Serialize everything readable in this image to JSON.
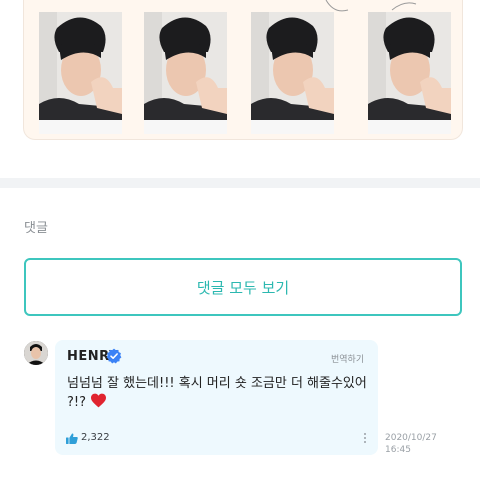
{
  "gallery": {
    "photos": [
      "photo-1",
      "photo-2",
      "photo-3",
      "photo-4"
    ]
  },
  "comments_section": {
    "title": "댓글",
    "view_all_label": "댓글 모두 보기"
  },
  "comment": {
    "author": "HENRY",
    "verified": true,
    "translate_label": "번역하기",
    "text": "넘넘넘 잘 했는데!!! 혹시 머리 숏 조금만 더 해줄수있어 ?!?",
    "like_count": "2,322",
    "date": "2020/10/27",
    "time": "16:45"
  },
  "colors": {
    "accent": "#3ec6be",
    "verified": "#3b82f6",
    "heart": "#e0242f",
    "bubble": "#eef9fe",
    "like_icon": "#2f9fd8"
  },
  "icons": [
    "verified-badge-icon",
    "heart-icon",
    "thumbs-up-icon",
    "more-vertical-icon"
  ]
}
